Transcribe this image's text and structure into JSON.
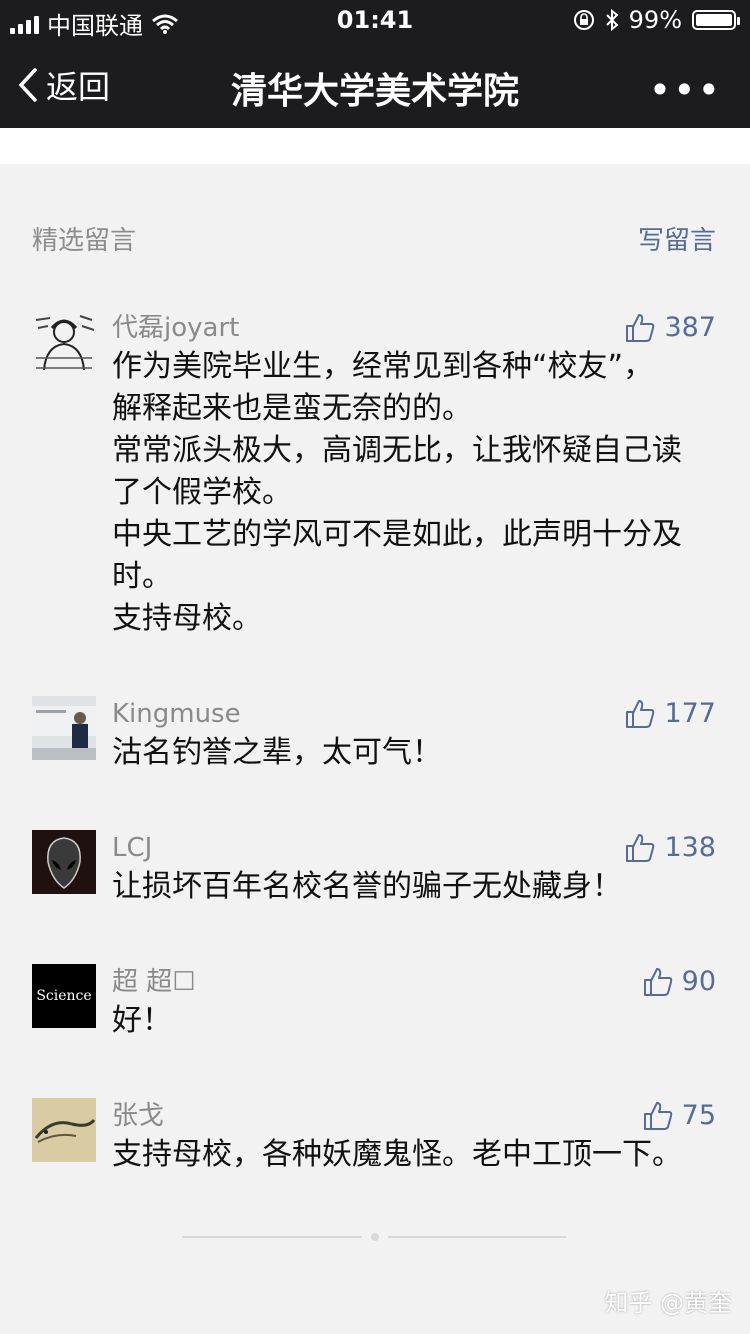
{
  "status": {
    "carrier": "中国联通",
    "time": "01:41",
    "battery": "99%"
  },
  "nav": {
    "back_label": "返回",
    "title": "清华大学美术学院",
    "more_label": "•••"
  },
  "section": {
    "label": "精选留言",
    "write_label": "写留言"
  },
  "comments": [
    {
      "name": "代磊joyart",
      "likes": "387",
      "lines": [
        "作为美院毕业生，经常见到各种“校友”，",
        "解释起来也是蛮无奈的的。",
        "常常派头极大，高调无比，让我怀疑自己读",
        "了个假学校。",
        "中央工艺的学风可不是如此，此声明十分及",
        "时。",
        "支持母校。"
      ]
    },
    {
      "name": "Kingmuse",
      "likes": "177",
      "lines": [
        "沽名钓誉之辈，太可气！"
      ]
    },
    {
      "name": "LCJ",
      "likes": "138",
      "lines": [
        "让损坏百年名校名誉的骗子无处藏身！"
      ]
    },
    {
      "name": "超 超☐",
      "likes": "90",
      "avatar_text": "Science",
      "lines": [
        "好！"
      ]
    },
    {
      "name": "张戈",
      "likes": "75",
      "lines": [
        "支持母校，各种妖魔鬼怪。老中工顶一下。"
      ]
    }
  ],
  "watermark": "知乎 @黄奎",
  "colors": {
    "link": "#576b95",
    "nav_bg": "#1c1c1e",
    "page_bg": "#f2f2f2"
  }
}
